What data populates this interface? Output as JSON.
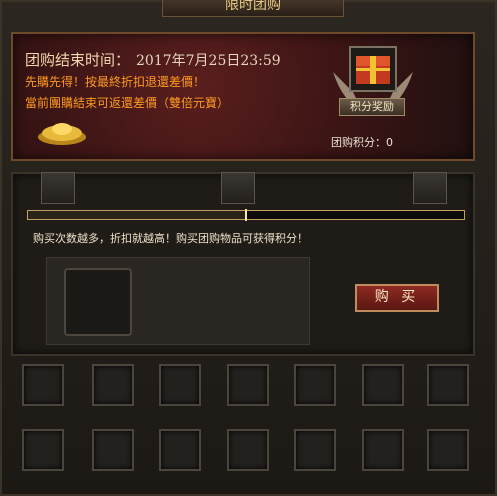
{
  "window": {
    "title": "限时团购"
  },
  "top_panel": {
    "end_time_label": "团购结束时间：",
    "end_time_value": "2017年7月25日23:59",
    "line1": "先購先得！按最終折扣退還差價！",
    "line2": "當前團購結束可返還差價（雙倍元寶）",
    "reward_label": "积分奖励",
    "points_label": "团购积分：0"
  },
  "middle": {
    "progress_fraction": 0.5,
    "hint": "购买次数越多，折扣就越高！购买团购物品可获得积分！",
    "buy_label": "购 买"
  }
}
